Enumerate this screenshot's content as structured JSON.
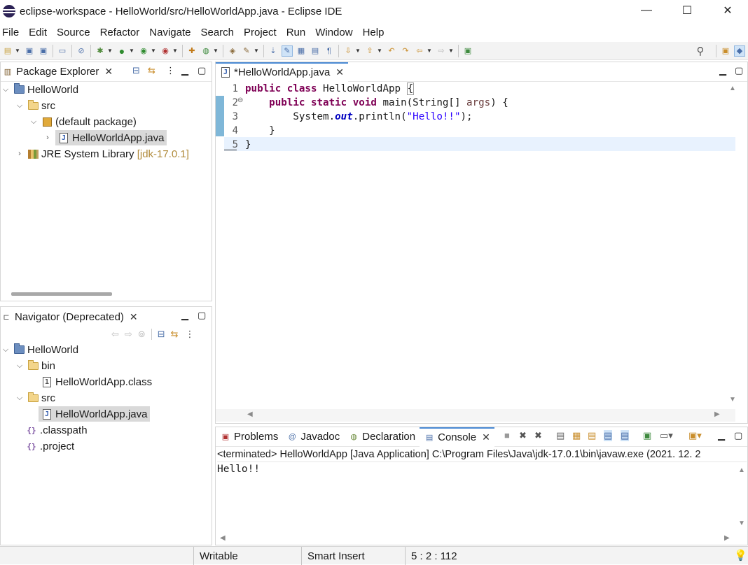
{
  "window": {
    "title": "eclipse-workspace - HelloWorld/src/HelloWorldApp.java - Eclipse IDE",
    "minimize": "—",
    "maximize": "☐",
    "close": "✕"
  },
  "menu": [
    "File",
    "Edit",
    "Source",
    "Refactor",
    "Navigate",
    "Search",
    "Project",
    "Run",
    "Window",
    "Help"
  ],
  "package_explorer": {
    "title": "Package Explorer",
    "tree": {
      "project": "HelloWorld",
      "src": "src",
      "default_package": "(default package)",
      "file": "HelloWorldApp.java",
      "jre": "JRE System Library",
      "jre_version": "[jdk-17.0.1]"
    }
  },
  "navigator": {
    "title": "Navigator (Deprecated)",
    "tree": {
      "project": "HelloWorld",
      "bin": "bin",
      "class_file": "HelloWorldApp.class",
      "src": "src",
      "java_file": "HelloWorldApp.java",
      "classpath": ".classpath",
      "project_file": ".project"
    }
  },
  "editor": {
    "tab": "*HelloWorldApp.java",
    "line_numbers": [
      "1",
      "2",
      "3",
      "4",
      "5"
    ],
    "code": {
      "l1_kw": "public class",
      "l1_rest": " HelloWorldApp ",
      "l1_brace": "{",
      "l2_indent": "    ",
      "l2_kw": "public static void",
      "l2_mid": " main(String[] ",
      "l2_param": "args",
      "l2_end": ") {",
      "l3_pre": "        System.",
      "l3_field": "out",
      "l3_call": ".println(",
      "l3_str": "\"Hello!!\"",
      "l3_end": ");",
      "l4": "    }",
      "l5": "}"
    }
  },
  "bottom_panel": {
    "tabs": [
      "Problems",
      "Javadoc",
      "Declaration",
      "Console"
    ],
    "console_header": "<terminated> HelloWorldApp [Java Application] C:\\Program Files\\Java\\jdk-17.0.1\\bin\\javaw.exe  (2021. 12. 2",
    "console_output": "Hello!!"
  },
  "status": {
    "mode": "Writable",
    "insert": "Smart Insert",
    "position": "5 : 2 : 112"
  },
  "colors": {
    "keyword": "#7f0055",
    "string": "#2a00ff",
    "field": "#0000c0",
    "current_line": "#e8f2fe"
  }
}
